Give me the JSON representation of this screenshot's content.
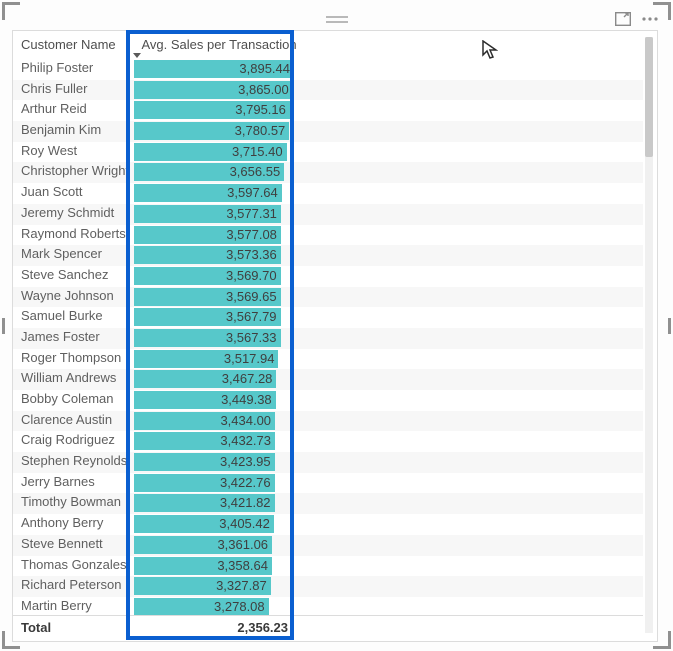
{
  "columns": {
    "name": "Customer Name",
    "value": "Avg. Sales per Transaction"
  },
  "rows": [
    {
      "name": "Philip Foster",
      "value": 3895.44,
      "label": "3,895.44"
    },
    {
      "name": "Chris Fuller",
      "value": 3865.0,
      "label": "3,865.00"
    },
    {
      "name": "Arthur Reid",
      "value": 3795.16,
      "label": "3,795.16"
    },
    {
      "name": "Benjamin Kim",
      "value": 3780.57,
      "label": "3,780.57"
    },
    {
      "name": "Roy West",
      "value": 3715.4,
      "label": "3,715.40"
    },
    {
      "name": "Christopher Wright",
      "value": 3656.55,
      "label": "3,656.55"
    },
    {
      "name": "Juan Scott",
      "value": 3597.64,
      "label": "3,597.64"
    },
    {
      "name": "Jeremy Schmidt",
      "value": 3577.31,
      "label": "3,577.31"
    },
    {
      "name": "Raymond Roberts",
      "value": 3577.08,
      "label": "3,577.08"
    },
    {
      "name": "Mark Spencer",
      "value": 3573.36,
      "label": "3,573.36"
    },
    {
      "name": "Steve Sanchez",
      "value": 3569.7,
      "label": "3,569.70"
    },
    {
      "name": "Wayne Johnson",
      "value": 3569.65,
      "label": "3,569.65"
    },
    {
      "name": "Samuel Burke",
      "value": 3567.79,
      "label": "3,567.79"
    },
    {
      "name": "James Foster",
      "value": 3567.33,
      "label": "3,567.33"
    },
    {
      "name": "Roger Thompson",
      "value": 3517.94,
      "label": "3,517.94"
    },
    {
      "name": "William Andrews",
      "value": 3467.28,
      "label": "3,467.28"
    },
    {
      "name": "Bobby Coleman",
      "value": 3449.38,
      "label": "3,449.38"
    },
    {
      "name": "Clarence Austin",
      "value": 3434.0,
      "label": "3,434.00"
    },
    {
      "name": "Craig Rodriguez",
      "value": 3432.73,
      "label": "3,432.73"
    },
    {
      "name": "Stephen Reynolds",
      "value": 3423.95,
      "label": "3,423.95"
    },
    {
      "name": "Jerry Barnes",
      "value": 3422.76,
      "label": "3,422.76"
    },
    {
      "name": "Timothy Bowman",
      "value": 3421.82,
      "label": "3,421.82"
    },
    {
      "name": "Anthony Berry",
      "value": 3405.42,
      "label": "3,405.42"
    },
    {
      "name": "Steve Bennett",
      "value": 3361.06,
      "label": "3,361.06"
    },
    {
      "name": "Thomas Gonzales",
      "value": 3358.64,
      "label": "3,358.64"
    },
    {
      "name": "Richard Peterson",
      "value": 3327.87,
      "label": "3,327.87"
    },
    {
      "name": "Martin Berry",
      "value": 3278.08,
      "label": "3,278.08"
    }
  ],
  "total": {
    "label": "Total",
    "value": 2356.23,
    "display": "2,356.23"
  },
  "chart_data": {
    "type": "bar",
    "title": "Avg. Sales per Transaction",
    "xlabel": "Avg. Sales per Transaction",
    "ylabel": "Customer Name",
    "xlim": [
      0,
      4000
    ],
    "categories": [
      "Philip Foster",
      "Chris Fuller",
      "Arthur Reid",
      "Benjamin Kim",
      "Roy West",
      "Christopher Wright",
      "Juan Scott",
      "Jeremy Schmidt",
      "Raymond Roberts",
      "Mark Spencer",
      "Steve Sanchez",
      "Wayne Johnson",
      "Samuel Burke",
      "James Foster",
      "Roger Thompson",
      "William Andrews",
      "Bobby Coleman",
      "Clarence Austin",
      "Craig Rodriguez",
      "Stephen Reynolds",
      "Jerry Barnes",
      "Timothy Bowman",
      "Anthony Berry",
      "Steve Bennett",
      "Thomas Gonzales",
      "Richard Peterson",
      "Martin Berry"
    ],
    "values": [
      3895.44,
      3865.0,
      3795.16,
      3780.57,
      3715.4,
      3656.55,
      3597.64,
      3577.31,
      3577.08,
      3573.36,
      3569.7,
      3569.65,
      3567.79,
      3567.33,
      3517.94,
      3467.28,
      3449.38,
      3434.0,
      3432.73,
      3423.95,
      3422.76,
      3421.82,
      3405.42,
      3361.06,
      3358.64,
      3327.87,
      3278.08
    ],
    "total": 2356.23
  }
}
